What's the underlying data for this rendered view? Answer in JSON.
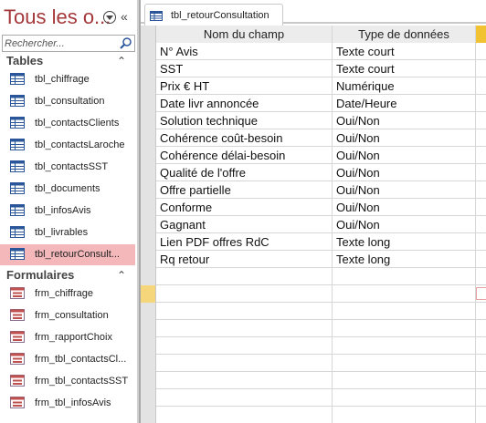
{
  "nav": {
    "title": "Tous les o...",
    "search_placeholder": "Rechercher...",
    "sections": [
      {
        "title": "Tables",
        "items": [
          {
            "label": "tbl_chiffrage",
            "icon": "table-icon"
          },
          {
            "label": "tbl_consultation",
            "icon": "table-icon"
          },
          {
            "label": "tbl_contactsClients",
            "icon": "table-icon"
          },
          {
            "label": "tbl_contactsLaroche",
            "icon": "table-icon"
          },
          {
            "label": "tbl_contactsSST",
            "icon": "table-icon"
          },
          {
            "label": "tbl_documents",
            "icon": "table-icon"
          },
          {
            "label": "tbl_infosAvis",
            "icon": "table-icon"
          },
          {
            "label": "tbl_livrables",
            "icon": "table-icon"
          },
          {
            "label": "tbl_retourConsult...",
            "icon": "table-icon",
            "selected": true
          }
        ]
      },
      {
        "title": "Formulaires",
        "items": [
          {
            "label": "frm_chiffrage",
            "icon": "form-icon"
          },
          {
            "label": "frm_consultation",
            "icon": "form-icon"
          },
          {
            "label": "frm_rapportChoix",
            "icon": "form-icon"
          },
          {
            "label": "frm_tbl_contactsCl...",
            "icon": "form-icon"
          },
          {
            "label": "frm_tbl_contactsSST",
            "icon": "form-icon"
          },
          {
            "label": "frm_tbl_infosAvis",
            "icon": "form-icon"
          }
        ]
      }
    ]
  },
  "tab": {
    "label": "tbl_retourConsultation"
  },
  "grid": {
    "columns": [
      "Nom du champ",
      "Type de données"
    ],
    "rows": [
      [
        "N° Avis",
        "Texte court"
      ],
      [
        "SST",
        "Texte court"
      ],
      [
        "Prix € HT",
        "Numérique"
      ],
      [
        "Date livr annoncée",
        "Date/Heure"
      ],
      [
        "Solution technique",
        "Oui/Non"
      ],
      [
        "Cohérence coût-besoin",
        "Oui/Non"
      ],
      [
        "Cohérence délai-besoin",
        "Oui/Non"
      ],
      [
        "Qualité de l'offre",
        "Oui/Non"
      ],
      [
        "Offre partielle",
        "Oui/Non"
      ],
      [
        "Conforme",
        "Oui/Non"
      ],
      [
        "Gagnant",
        "Oui/Non"
      ],
      [
        "Lien PDF offres RdC",
        "Texte long"
      ],
      [
        "Rq retour",
        "Texte long"
      ]
    ]
  },
  "colors": {
    "title": "#a4373a",
    "selected_item": "#f4b8bb",
    "header_accent": "#f1c232",
    "new_row_selector": "#f6d67a"
  }
}
